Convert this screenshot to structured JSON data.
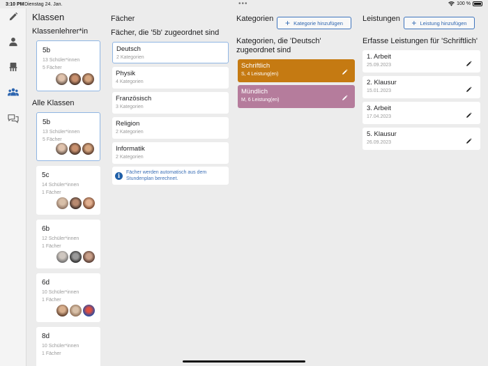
{
  "status_bar": {
    "time": "3:10 PM",
    "date": "Dienstag 24. Jan.",
    "battery": "100 %"
  },
  "sidebar": {
    "icons": [
      "pencil-icon",
      "person-icon",
      "chair-icon",
      "group-icon",
      "chat-icon"
    ],
    "active": "group-icon",
    "accent_color": "#2e66b0"
  },
  "klassen": {
    "title": "Klassen",
    "klassenlehrer_label": "Klassenlehrer*in",
    "klassenlehrer_class": {
      "name": "5b",
      "students": "13 Schüler*innen",
      "subjects": "5 Fächer"
    },
    "alle_label": "Alle Klassen",
    "alle": [
      {
        "name": "5b",
        "students": "13 Schüler*innen",
        "subjects": "5 Fächer"
      },
      {
        "name": "5c",
        "students": "14 Schüler*innen",
        "subjects": "1 Fächer"
      },
      {
        "name": "6b",
        "students": "12 Schüler*innen",
        "subjects": "1 Fächer"
      },
      {
        "name": "6d",
        "students": "10 Schüler*innen",
        "subjects": "1 Fächer"
      },
      {
        "name": "8d",
        "students": "10 Schüler*innen",
        "subjects": "1 Fächer"
      }
    ]
  },
  "faecher": {
    "title": "Fächer",
    "subtitle": "Fächer, die '5b' zugeordnet sind",
    "items": [
      {
        "name": "Deutsch",
        "count": "2 Kategorien"
      },
      {
        "name": "Physik",
        "count": "4 Kategorien"
      },
      {
        "name": "Französisch",
        "count": "3 Kategorien"
      },
      {
        "name": "Religion",
        "count": "2 Kategorien"
      },
      {
        "name": "Informatik",
        "count": "2 Kategorien"
      }
    ],
    "info": "Fächer werden automatisch aus dem Stundenplan berechnet."
  },
  "kategorien": {
    "title": "Kategorien",
    "add_button": "Kategorie hinzufügen",
    "subtitle": "Kategorien, die 'Deutsch' zugeordnet sind",
    "items": [
      {
        "name": "Schriftlich",
        "detail": "S, 4 Leistung(en)",
        "color": "#c57a12"
      },
      {
        "name": "Mündlich",
        "detail": "M, 6 Leistung(en)",
        "color": "#b57c9c"
      }
    ]
  },
  "leistungen": {
    "title": "Leistungen",
    "add_button": "Leistung hinzufügen",
    "subtitle": "Erfasse Leistungen für 'Schriftlich'",
    "items": [
      {
        "name": "1. Arbeit",
        "date": "25.09.2023"
      },
      {
        "name": "2. Klausur",
        "date": "15.01.2023"
      },
      {
        "name": "3. Arbeit",
        "date": "17.04.2023"
      },
      {
        "name": "5. Klausur",
        "date": "26.09.2023"
      }
    ]
  }
}
